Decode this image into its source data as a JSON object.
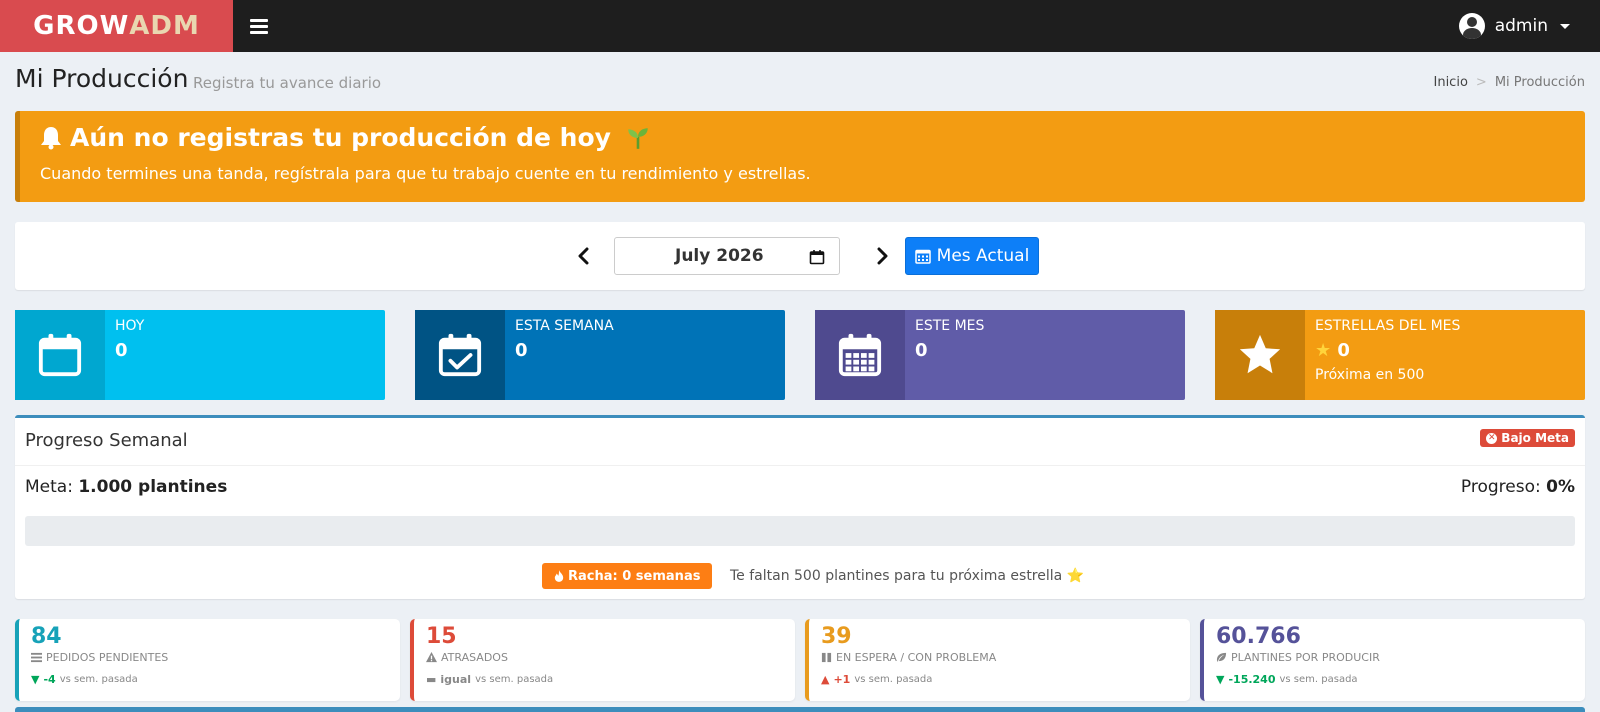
{
  "brand": {
    "part1": "GROW",
    "part2": "ADM"
  },
  "user": {
    "name": "admin"
  },
  "header": {
    "title": "Mi Producción",
    "subtitle": "Registra tu avance diario"
  },
  "breadcrumb": {
    "home": "Inicio",
    "current": "Mi Producción"
  },
  "alert": {
    "title": "Aún no registras tu producción de hoy",
    "message": "Cuando termines una tanda, regístrala para que tu trabajo cuente en tu rendimiento y estrellas."
  },
  "month_selector": {
    "value": "July 2026",
    "current_button": "Mes Actual"
  },
  "info_boxes": [
    {
      "label": "HOY",
      "value": "0",
      "color": "#00c0ef",
      "icon_color": "#00a7d0",
      "icon": "calendar-icon"
    },
    {
      "label": "ESTA SEMANA",
      "value": "0",
      "color": "#0073b7",
      "icon_color": "#005384",
      "icon": "calendar-check-icon"
    },
    {
      "label": "ESTE MES",
      "value": "0",
      "color": "#605ca8",
      "icon_color": "#4f4a8f",
      "icon": "calendar-grid-icon"
    },
    {
      "label": "ESTRELLAS DEL MES",
      "value": "0",
      "extra": "Próxima en 500",
      "color": "#f39c12",
      "icon_color": "#c87f0a",
      "icon": "star-icon"
    }
  ],
  "progress": {
    "title": "Progreso Semanal",
    "badge": "Bajo Meta",
    "meta_label": "Meta:",
    "meta_value": "1.000 plantines",
    "progress_label": "Progreso:",
    "progress_value": "0%",
    "fraction": 0,
    "streak": "Racha: 0 semanas",
    "missing": "Te faltan 500 plantines para tu próxima estrella ⭐"
  },
  "stats": [
    {
      "value": "84",
      "label": "PEDIDOS PENDIENTES",
      "delta": "-4",
      "delta_dir": "down",
      "compare": "vs sem. pasada",
      "color": "#17a2b8",
      "delta_color": "#00a65a",
      "icon": "list-icon"
    },
    {
      "value": "15",
      "label": "ATRASADOS",
      "delta": "igual",
      "delta_dir": "same",
      "compare": "vs sem. pasada",
      "color": "#dd4b39",
      "delta_color": "#888888",
      "icon": "warning-icon"
    },
    {
      "value": "39",
      "label": "EN ESPERA / CON PROBLEMA",
      "delta": "+1",
      "delta_dir": "up",
      "compare": "vs sem. pasada",
      "color": "#e89b1e",
      "delta_color": "#dd4b39",
      "icon": "pause-icon"
    },
    {
      "value": "60.766",
      "label": "PLANTINES POR PRODUCIR",
      "delta": "-15.240",
      "delta_dir": "down",
      "compare": "vs sem. pasada",
      "color": "#555299",
      "delta_color": "#00a65a",
      "icon": "leaf-icon"
    }
  ]
}
